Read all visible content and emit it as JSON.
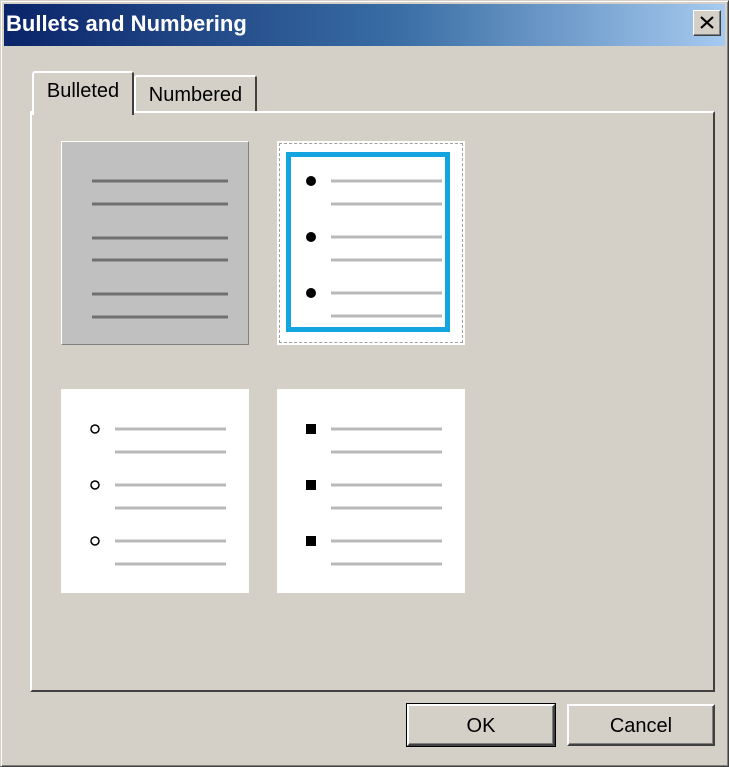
{
  "window": {
    "title": "Bullets and Numbering",
    "close_icon": "close-x-icon"
  },
  "tabs": [
    {
      "label": "Bulleted",
      "active": true
    },
    {
      "label": "Numbered",
      "active": false
    }
  ],
  "bullet_styles": [
    {
      "style": "none",
      "selected": false,
      "icon": "no-bullet-list-icon"
    },
    {
      "style": "filled-circle",
      "selected": true,
      "icon": "filled-circle-bullet-list-icon"
    },
    {
      "style": "hollow-circle",
      "selected": false,
      "icon": "hollow-circle-bullet-list-icon"
    },
    {
      "style": "filled-square",
      "selected": false,
      "icon": "filled-square-bullet-list-icon"
    }
  ],
  "buttons": {
    "ok_label": "OK",
    "cancel_label": "Cancel"
  },
  "colors": {
    "selection_accent": "#14a4e0",
    "title_gradient_start": "#0a246a",
    "title_gradient_end": "#a6caf0",
    "dialog_face": "#d4d0c8"
  }
}
